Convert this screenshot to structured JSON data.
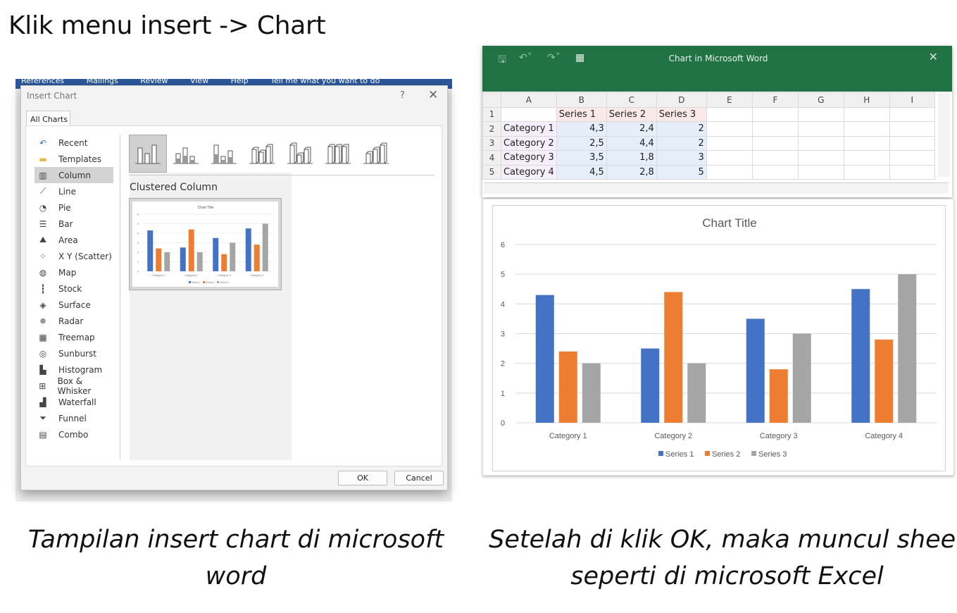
{
  "heading": "Klik menu insert -> Chart",
  "caption_left": "Tampilan insert chart di microsoft word",
  "caption_right": "Setelah di klik OK, maka muncul sheet seperti di microsoft Excel",
  "word_ribbon": [
    "References",
    "Mailings",
    "Review",
    "View",
    "Help",
    "Tell me what you want to do"
  ],
  "dialog": {
    "title": "Insert Chart",
    "help": "?",
    "close": "✕",
    "tab": "All Charts",
    "categories": [
      {
        "label": "Recent",
        "icon": "recent-icon"
      },
      {
        "label": "Templates",
        "icon": "folder-icon"
      },
      {
        "label": "Column",
        "icon": "column-chart-icon"
      },
      {
        "label": "Line",
        "icon": "line-chart-icon"
      },
      {
        "label": "Pie",
        "icon": "pie-chart-icon"
      },
      {
        "label": "Bar",
        "icon": "bar-chart-icon"
      },
      {
        "label": "Area",
        "icon": "area-chart-icon"
      },
      {
        "label": "X Y (Scatter)",
        "icon": "scatter-chart-icon"
      },
      {
        "label": "Map",
        "icon": "map-chart-icon"
      },
      {
        "label": "Stock",
        "icon": "stock-chart-icon"
      },
      {
        "label": "Surface",
        "icon": "surface-chart-icon"
      },
      {
        "label": "Radar",
        "icon": "radar-chart-icon"
      },
      {
        "label": "Treemap",
        "icon": "treemap-chart-icon"
      },
      {
        "label": "Sunburst",
        "icon": "sunburst-chart-icon"
      },
      {
        "label": "Histogram",
        "icon": "histogram-chart-icon"
      },
      {
        "label": "Box & Whisker",
        "icon": "box-whisker-chart-icon"
      },
      {
        "label": "Waterfall",
        "icon": "waterfall-chart-icon"
      },
      {
        "label": "Funnel",
        "icon": "funnel-chart-icon"
      },
      {
        "label": "Combo",
        "icon": "combo-chart-icon"
      }
    ],
    "selected_category": "Column",
    "subtype_title": "Clustered Column",
    "ok": "OK",
    "cancel": "Cancel"
  },
  "excel": {
    "title": "Chart in Microsoft Word",
    "close": "✕",
    "columns": [
      "A",
      "B",
      "C",
      "D",
      "E",
      "F",
      "G",
      "H",
      "I"
    ],
    "rows": [
      {
        "n": "1",
        "cells": [
          "",
          "Series 1",
          "Series 2",
          "Series 3"
        ]
      },
      {
        "n": "2",
        "cells": [
          "Category 1",
          "4,3",
          "2,4",
          "2"
        ]
      },
      {
        "n": "3",
        "cells": [
          "Category 2",
          "2,5",
          "4,4",
          "2"
        ]
      },
      {
        "n": "4",
        "cells": [
          "Category 3",
          "3,5",
          "1,8",
          "3"
        ]
      },
      {
        "n": "5",
        "cells": [
          "Category 4",
          "4,5",
          "2,8",
          "5"
        ]
      }
    ]
  },
  "colors": {
    "series1": "#4472c4",
    "series2": "#ed7d31",
    "series3": "#a5a5a5",
    "excel_green": "#217346"
  },
  "chart_data": {
    "type": "bar",
    "title": "Chart Title",
    "categories": [
      "Category 1",
      "Category 2",
      "Category 3",
      "Category 4"
    ],
    "series": [
      {
        "name": "Series 1",
        "values": [
          4.3,
          2.5,
          3.5,
          4.5
        ]
      },
      {
        "name": "Series 2",
        "values": [
          2.4,
          4.4,
          1.8,
          2.8
        ]
      },
      {
        "name": "Series 3",
        "values": [
          2,
          2,
          3,
          5
        ]
      }
    ],
    "ylim": [
      0,
      6
    ],
    "yticks": [
      "0",
      "1",
      "2",
      "3",
      "4",
      "5",
      "6"
    ],
    "grid": true,
    "legend": "bottom"
  },
  "preview_chart": {
    "title": "Chart Title",
    "yticks": [
      "0",
      "1",
      "2",
      "3",
      "4",
      "5",
      "6"
    ],
    "categories": [
      "Category 1",
      "Category 2",
      "Category 3",
      "Category 4"
    ],
    "legend": [
      "Series 1",
      "Series 2",
      "Series 3"
    ]
  }
}
